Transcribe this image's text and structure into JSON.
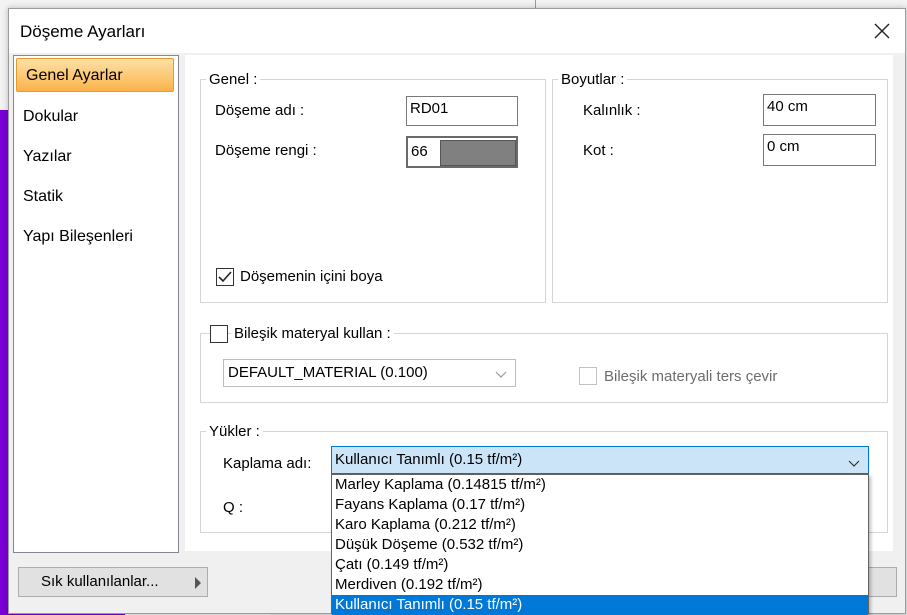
{
  "dialog": {
    "title": "Döşeme Ayarları"
  },
  "sidebar": {
    "items": [
      {
        "label": "Genel Ayarlar",
        "active": true
      },
      {
        "label": "Dokular"
      },
      {
        "label": "Yazılar"
      },
      {
        "label": "Statik"
      },
      {
        "label": "Yapı Bileşenleri"
      }
    ]
  },
  "genel": {
    "legend": "Genel :",
    "name_label": "Döşeme adı  :",
    "name_value": "RD01",
    "color_label": "Döşeme rengi :",
    "color_value": "66",
    "color_swatch": "#808080",
    "fill_label": "Döşemenin içini boya",
    "fill_checked": true
  },
  "boyutlar": {
    "legend": "Boyutlar :",
    "thickness_label": "Kalınlık :",
    "thickness_value": "40 cm",
    "kot_label": "Kot :",
    "kot_value": "0 cm"
  },
  "material": {
    "use_label": "Bileşik materyal kullan :",
    "use_checked": false,
    "selected": "DEFAULT_MATERIAL (0.100)",
    "reverse_label": "Bileşik materyali ters çevir"
  },
  "yukler": {
    "legend": "Yükler :",
    "kaplama_label": "Kaplama adı:",
    "kaplama_selected": "Kullanıcı Tanımlı (0.15 tf/m²)",
    "q_label": "Q :",
    "options": [
      "Marley Kaplama (0.14815 tf/m²)",
      "Fayans Kaplama (0.17 tf/m²)",
      "Karo Kaplama (0.212 tf/m²)",
      "Düşük Döşeme (0.532 tf/m²)",
      "Çatı (0.149 tf/m²)",
      "Merdiven (0.192 tf/m²)",
      "Kullanıcı Tanımlı (0.15 tf/m²)"
    ]
  },
  "footer": {
    "favorites_label": "Sık kullanılanlar..."
  },
  "colors": {
    "accent": "#0078d7",
    "highlight": "#cce4f7",
    "nav_active": "#fbb34a"
  }
}
